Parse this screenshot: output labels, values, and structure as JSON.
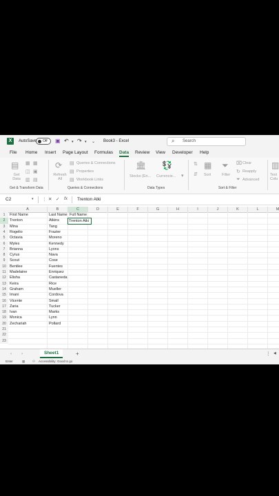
{
  "titlebar": {
    "autosave_label": "AutoSave",
    "autosave_state": "Off",
    "doc_title": "Book3 - Excel",
    "search_placeholder": "Search"
  },
  "menu": {
    "tabs": [
      "File",
      "Home",
      "Insert",
      "Page Layout",
      "Formulas",
      "Data",
      "Review",
      "View",
      "Developer",
      "Help"
    ],
    "active": "Data"
  },
  "ribbon": {
    "get_data": "Get Data",
    "refresh_all": "Refresh All",
    "queries_connections": "Queries & Connections",
    "properties": "Properties",
    "workbook_links": "Workbook Links",
    "stocks": "Stocks (En...",
    "currencies": "Currencie...",
    "sort": "Sort",
    "filter": "Filter",
    "clear": "Clear",
    "reapply": "Reapply",
    "advanced": "Advanced",
    "text_to_columns": "Text Colu",
    "groups": {
      "get_transform": "Get & Transform Data",
      "queries": "Queries & Connections",
      "data_types": "Data Types",
      "sort_filter": "Sort & Filter"
    }
  },
  "formula_bar": {
    "name_box": "C2",
    "formula": "Trenton Atki"
  },
  "grid": {
    "columns": [
      "A",
      "B",
      "C",
      "D",
      "E",
      "F",
      "G",
      "H",
      "I",
      "J",
      "K",
      "L",
      "M"
    ],
    "row_numbers": [
      "1",
      "2",
      "3",
      "4",
      "5",
      "6",
      "7",
      "8",
      "9",
      "10",
      "11",
      "12",
      "13",
      "14",
      "15",
      "16",
      "17",
      "18",
      "19",
      "20",
      "21",
      "22",
      "23"
    ],
    "headers": [
      "First Name",
      "Last Name",
      "Full Name"
    ],
    "rows": [
      [
        "Trenton",
        "Atkins"
      ],
      [
        "Mina",
        "Tang"
      ],
      [
        "Rogelio",
        "Frazier"
      ],
      [
        "Octavia",
        "Moreno"
      ],
      [
        "Myles",
        "Kennedy"
      ],
      [
        "Brianna",
        "Lyons"
      ],
      [
        "Cyrus",
        "Nava"
      ],
      [
        "Scout",
        "Cose"
      ],
      [
        "Bentlee",
        "Fuentes"
      ],
      [
        "Madelaine",
        "Enriquez"
      ],
      [
        "Elisha",
        "Castaneda"
      ],
      [
        "Keira",
        "Rice"
      ],
      [
        "Graham",
        "Mueller"
      ],
      [
        "Imani",
        "Cordova"
      ],
      [
        "Vicente",
        "Small"
      ],
      [
        "Zaria",
        "Tucker"
      ],
      [
        "Ivan",
        "Marks"
      ],
      [
        "Monica",
        "Lynn"
      ],
      [
        "Zechariah",
        "Pollard"
      ]
    ],
    "active_cell_value": "Trenton Atki"
  },
  "sheets": {
    "tabs": [
      "Sheet1"
    ],
    "add_label": "+"
  },
  "status": {
    "mode": "Enter",
    "accessibility": "Accessibility: Good to go"
  }
}
